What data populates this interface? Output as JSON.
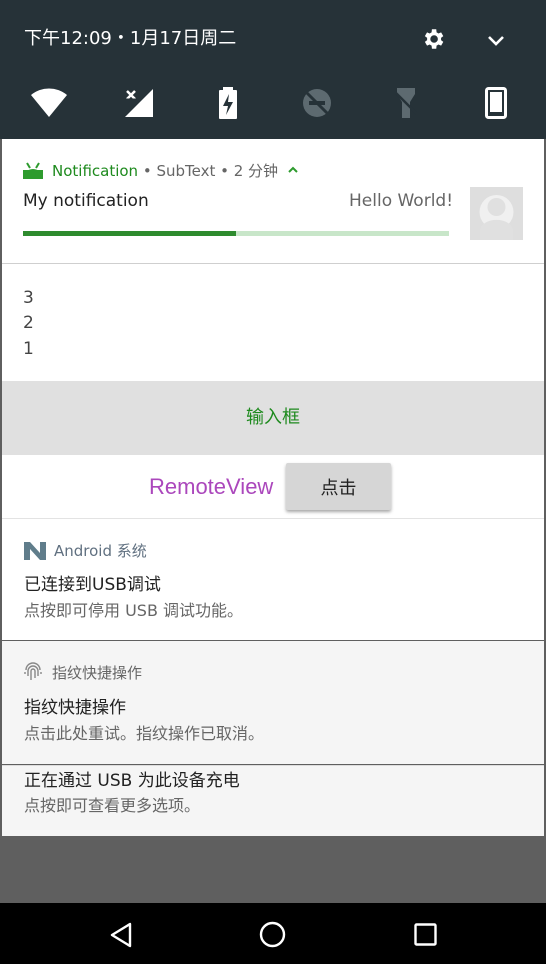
{
  "status_bar": {
    "time_date": "下午12:09・1月17日周二"
  },
  "quick_settings": {
    "icons": [
      "wifi-icon",
      "no-signal-icon",
      "battery-charging-icon",
      "do-not-disturb-off-icon",
      "flashlight-off-icon",
      "phone-icon"
    ]
  },
  "notification": {
    "app_name": "Notification",
    "sub_text": "• SubText • 2 分钟",
    "title": "My notification",
    "text": "Hello World!",
    "progress": 0.5,
    "list": [
      "3",
      "2",
      "1"
    ],
    "input_label": "输入框",
    "remote_view_label": "RemoteView",
    "button_label": "点击",
    "accent": "#1e8a1e"
  },
  "usb_debug": {
    "app": "Android 系统",
    "title": "已连接到USB调试",
    "text": "点按即可停用 USB 调试功能。"
  },
  "fingerprint": {
    "app": "指纹快捷操作",
    "title": "指纹快捷操作",
    "text": "点击此处重试。指纹操作已取消。"
  },
  "charging": {
    "title": "正在通过 USB 为此设备充电",
    "text": "点按即可查看更多选项。"
  }
}
